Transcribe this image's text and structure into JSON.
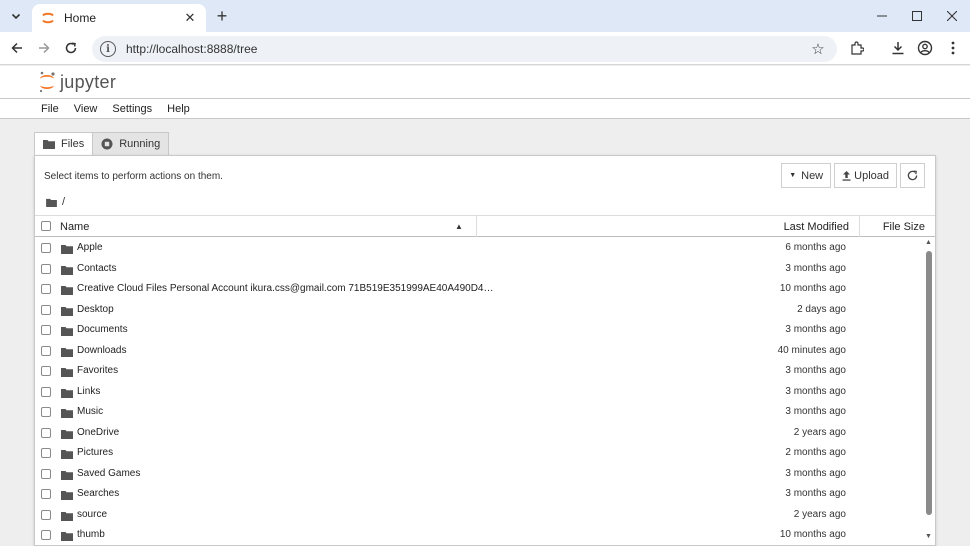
{
  "browser": {
    "tab_title": "Home",
    "url": "http://localhost:8888/tree"
  },
  "app": {
    "logo_text": "jupyter",
    "accent_color": "#f37626"
  },
  "menu": [
    "File",
    "View",
    "Settings",
    "Help"
  ],
  "panel_tabs": {
    "files": "Files",
    "running": "Running"
  },
  "toolbar": {
    "hint": "Select items to perform actions on them.",
    "new_label": "New",
    "upload_label": "Upload",
    "refresh_icon": "refresh-icon"
  },
  "breadcrumb": {
    "path": "/"
  },
  "columns": {
    "name": "Name",
    "last_modified": "Last Modified",
    "file_size": "File Size"
  },
  "items": [
    {
      "name": "Apple",
      "modified": "6 months ago"
    },
    {
      "name": "Contacts",
      "modified": "3 months ago"
    },
    {
      "name": "Creative Cloud Files Personal Account ikura.css@gmail.com 71B519E351999AE40A490D4…",
      "modified": "10 months ago"
    },
    {
      "name": "Desktop",
      "modified": "2 days ago"
    },
    {
      "name": "Documents",
      "modified": "3 months ago"
    },
    {
      "name": "Downloads",
      "modified": "40 minutes ago"
    },
    {
      "name": "Favorites",
      "modified": "3 months ago"
    },
    {
      "name": "Links",
      "modified": "3 months ago"
    },
    {
      "name": "Music",
      "modified": "3 months ago"
    },
    {
      "name": "OneDrive",
      "modified": "2 years ago"
    },
    {
      "name": "Pictures",
      "modified": "2 months ago"
    },
    {
      "name": "Saved Games",
      "modified": "3 months ago"
    },
    {
      "name": "Searches",
      "modified": "3 months ago"
    },
    {
      "name": "source",
      "modified": "2 years ago"
    },
    {
      "name": "thumb",
      "modified": "10 months ago"
    }
  ]
}
